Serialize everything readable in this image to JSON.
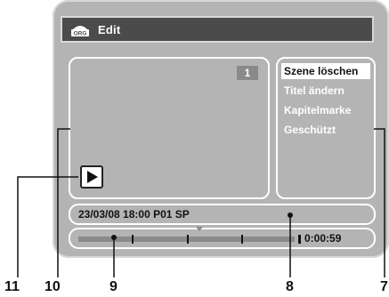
{
  "header": {
    "title": "Edit",
    "icon": "org-icon",
    "icon_label": "ORG"
  },
  "preview": {
    "scene_number": "1",
    "play_icon": "play-icon"
  },
  "menu": {
    "items": [
      {
        "label": "Szene löschen",
        "selected": true
      },
      {
        "label": "Titel ändern",
        "selected": false
      },
      {
        "label": "Kapitelmarke",
        "selected": false
      },
      {
        "label": "Geschützt",
        "selected": false
      }
    ]
  },
  "info": {
    "text": "23/03/08 18:00  P01  SP"
  },
  "progress": {
    "time": "0:00:59",
    "position_fraction": 0.6
  },
  "callouts": {
    "play_indicator": "11",
    "preview_window": "10",
    "progress_bar": "9",
    "info_bar": "8",
    "edit_menu": "7"
  },
  "colors": {
    "screen": "#b4b4b4",
    "title_bar": "#4b4b4b",
    "selected": "#ffffff"
  }
}
